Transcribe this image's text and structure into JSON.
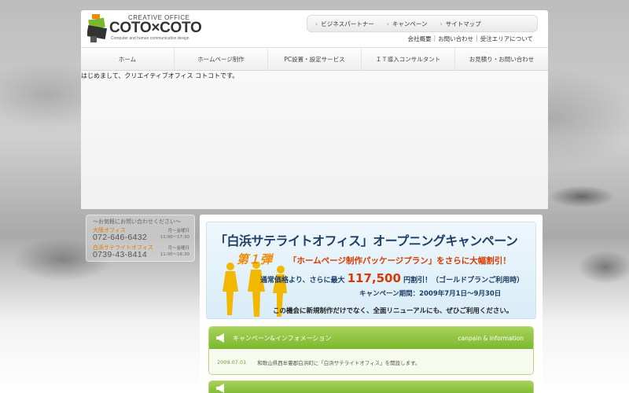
{
  "logo": {
    "small": "CREATIVE OFFICE",
    "big": "COTO×COTO",
    "tagline": "Computer and human communication design"
  },
  "topnav": [
    "ビジネスパートナー",
    "キャンペーン",
    "サイトマップ"
  ],
  "subnav": [
    "会社概要",
    "お問い合わせ",
    "受注エリアについて"
  ],
  "mainnav": [
    "ホーム",
    "ホームページ制作",
    "PC設置・設定サービス",
    "ＩＴ導入コンサルタント",
    "お見積り・お問い合わせ"
  ],
  "intro_text": "はじめまして、クリエイティブオフィス コトコトです。",
  "contact": {
    "heading": "～お気軽にお問い合わせください～",
    "offices": [
      {
        "name": "大阪オフィス",
        "tel": "072-646-6432",
        "days": "月～金曜日",
        "hours": "11:00～17:30"
      },
      {
        "name": "白浜サテライトオフィス",
        "tel": "0739-43-8414",
        "days": "月～金曜日",
        "hours": "11:00～16:30"
      }
    ]
  },
  "banner": {
    "title": "「白浜サテライトオフィス」オープニングキャンペーン",
    "episode": "第１弾",
    "line1": "「ホームページ制作パッケージプラン」をさらに大幅割引！",
    "line2_pre": "通常価格より、さらに最大",
    "price": "117,500",
    "line2_post": "円割引！（ゴールドプランご利用時）",
    "line3": "キャンペーン期間：2009年7月1日～9月30日",
    "line4": "この機会に新規制作だけでなく、全面リニューアルにも、ぜひご利用ください。"
  },
  "news": {
    "title": "キャンペーン&インフォメーション",
    "title_en": "canpain & information",
    "items": [
      {
        "date": "2009.07.01",
        "text": "和歌山県西牟婁郡白浜町に「白浜サテライトオフィス」を開設します。"
      }
    ]
  },
  "colors": {
    "accent_orange": "#f08a00",
    "green": "#7bb82e",
    "navy": "#1d3f66"
  }
}
